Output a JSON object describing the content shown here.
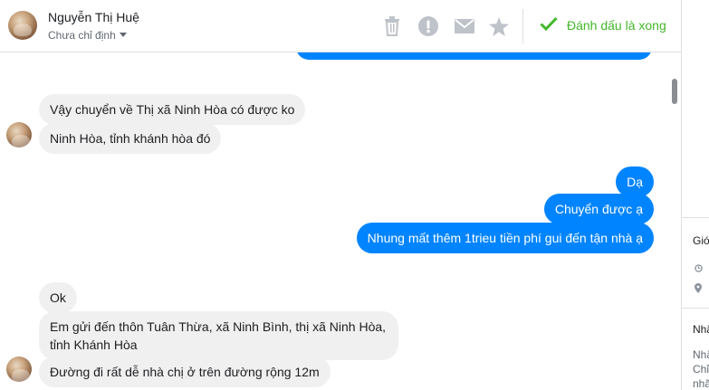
{
  "header": {
    "contact_name": "Nguyễn Thị Huệ",
    "assignee": "Chưa chỉ định",
    "actions": [
      {
        "icon": "trash-icon"
      },
      {
        "icon": "exclamation-icon"
      },
      {
        "icon": "envelope-icon"
      },
      {
        "icon": "star-icon"
      }
    ],
    "mark_done_label": "Đánh dấu là xong",
    "accent_color": "#42b72a"
  },
  "messages": [
    {
      "side": "in",
      "text": "Vậy chuyển về Thị xã Ninh Hòa có được ko"
    },
    {
      "side": "in",
      "text": "Ninh Hòa, tỉnh khánh hòa đó"
    },
    {
      "side": "out",
      "text": "Dạ"
    },
    {
      "side": "out",
      "text": "Chuyển được ạ"
    },
    {
      "side": "out",
      "text": "Nhung mất thêm 1trieu tiền phí gui đến tận nhà ạ"
    },
    {
      "side": "in",
      "text": "Ok"
    },
    {
      "side": "in",
      "text": "Em gửi đến thôn Tuân Thừa, xã Ninh Bình, thị xã Ninh Hòa,",
      "line2": "tỉnh Khánh Hòa"
    },
    {
      "side": "in",
      "text": "Đường đi rất dễ nhà chị ở trên đường rộng 12m"
    }
  ],
  "right_panel": {
    "section1_title": "Giớ",
    "section2_title": "Nhã",
    "section2_lines": [
      "Nhã",
      "Chỉ",
      "nhã"
    ]
  },
  "colors": {
    "outgoing_bubble": "#0084ff",
    "incoming_bubble": "#f1f0f0"
  }
}
